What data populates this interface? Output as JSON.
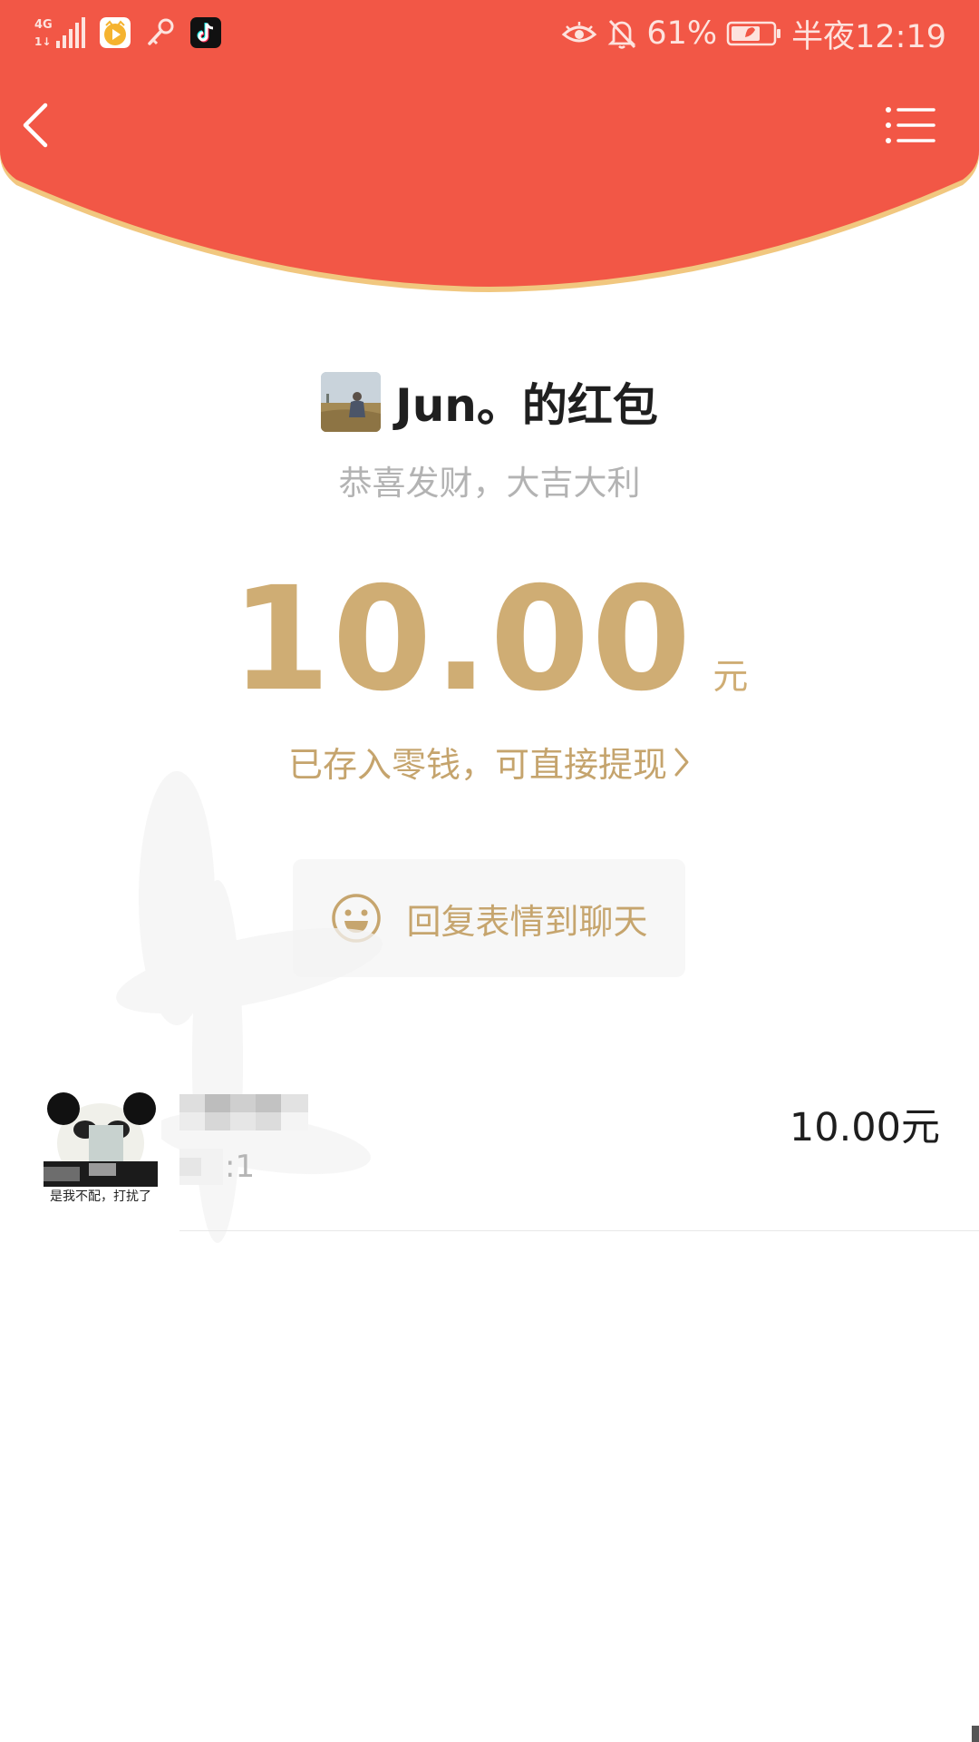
{
  "status_bar": {
    "network": "4G",
    "battery_percent": "61%",
    "time": "半夜12:19",
    "icons": [
      "signal-icon",
      "video-app-icon",
      "key-icon",
      "tiktok-icon",
      "eye-icon",
      "bell-off-icon",
      "battery-icon"
    ]
  },
  "colors": {
    "header_red": "#f25746",
    "header_trim": "#f1c77f",
    "gold": "#cfad74"
  },
  "header": {
    "back_icon": "chevron-left-icon",
    "menu_icon": "list-menu-icon"
  },
  "packet": {
    "sender_title": "Jun。的红包",
    "greeting": "恭喜发财，大吉大利",
    "amount": "10.00",
    "unit": "元",
    "deposit_note": "已存入零钱，可直接提现"
  },
  "reply_button": {
    "label": "回复表情到聊天",
    "icon": "smiley-icon"
  },
  "receivers": [
    {
      "sticker_caption": "是我不配，打扰了",
      "time_fragment": ":1",
      "amount": "10.00元"
    }
  ]
}
